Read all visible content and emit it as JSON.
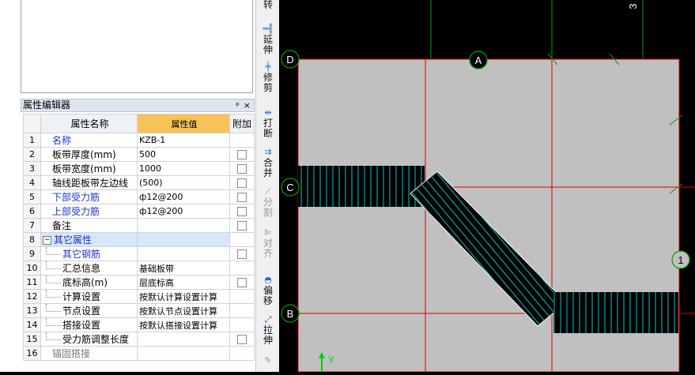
{
  "panel": {
    "title": "属性编辑器",
    "pin": "ᵖ",
    "close": "×",
    "columns": [
      "属性名称",
      "属性值",
      "附加"
    ],
    "rows": [
      {
        "num": "1",
        "name": "名称",
        "value": "KZB-1",
        "style": "blue",
        "check": false
      },
      {
        "num": "2",
        "name": "板带厚度(mm)",
        "value": "500",
        "style": "",
        "check": true
      },
      {
        "num": "3",
        "name": "板带宽度(mm)",
        "value": "1000",
        "style": "",
        "check": true
      },
      {
        "num": "4",
        "name": "轴线距板带左边线",
        "value": "(500)",
        "style": "",
        "check": true
      },
      {
        "num": "5",
        "name": "下部受力筋",
        "value": "ф12@200",
        "style": "blue",
        "check": true
      },
      {
        "num": "6",
        "name": "上部受力筋",
        "value": "ф12@200",
        "style": "blue",
        "check": true
      },
      {
        "num": "7",
        "name": "备注",
        "value": "",
        "style": "",
        "check": true
      },
      {
        "num": "8",
        "name": "其它属性",
        "value": "",
        "style": "group",
        "check": false
      },
      {
        "num": "9",
        "name": "其它钢筋",
        "value": "",
        "style": "blue child",
        "check": true
      },
      {
        "num": "10",
        "name": "汇总信息",
        "value": "基础板带",
        "style": "child",
        "check": false
      },
      {
        "num": "11",
        "name": "底标高(m)",
        "value": "层底标高",
        "style": "child",
        "check": true
      },
      {
        "num": "12",
        "name": "计算设置",
        "value": "按默认计算设置计算",
        "style": "child",
        "check": false
      },
      {
        "num": "13",
        "name": "节点设置",
        "value": "按默认节点设置计算",
        "style": "child",
        "check": false
      },
      {
        "num": "14",
        "name": "搭接设置",
        "value": "按默认搭接设置计算",
        "style": "child",
        "check": false
      },
      {
        "num": "15",
        "name": "受力筋调整长度",
        "value": "",
        "style": "child",
        "check": true
      },
      {
        "num": "16",
        "name": "锚固搭接",
        "value": "",
        "style": "grey group2",
        "check": false
      }
    ]
  },
  "toolbar": [
    {
      "icon": "⟲",
      "label": "转",
      "enabled": true
    },
    {
      "icon": "═╢",
      "label": "延伸",
      "enabled": true
    },
    {
      "icon": "╪",
      "label": "修剪",
      "enabled": true
    },
    {
      "icon": "⇹",
      "label": "打断",
      "enabled": true
    },
    {
      "icon": "⇉",
      "label": "合并",
      "enabled": true
    },
    {
      "icon": "⟋",
      "label": "分割",
      "enabled": false
    },
    {
      "icon": "⊫",
      "label": "对齐",
      "enabled": false
    },
    {
      "icon": "◓",
      "label": "偏移",
      "enabled": true
    },
    {
      "icon": "⤢",
      "label": "拉伸",
      "enabled": true
    },
    {
      "icon": "✎",
      "label": "",
      "enabled": false
    }
  ],
  "canvas": {
    "axis_labels": [
      "D",
      "A",
      "C",
      "B",
      "1",
      "3"
    ],
    "ucs_label": "Y",
    "colors": {
      "background": "#000000",
      "slab": "#c0c0c0",
      "gridline": "#e00000",
      "green": "#00a000",
      "strip": "#000000",
      "hatch": "#00c8c8"
    }
  }
}
